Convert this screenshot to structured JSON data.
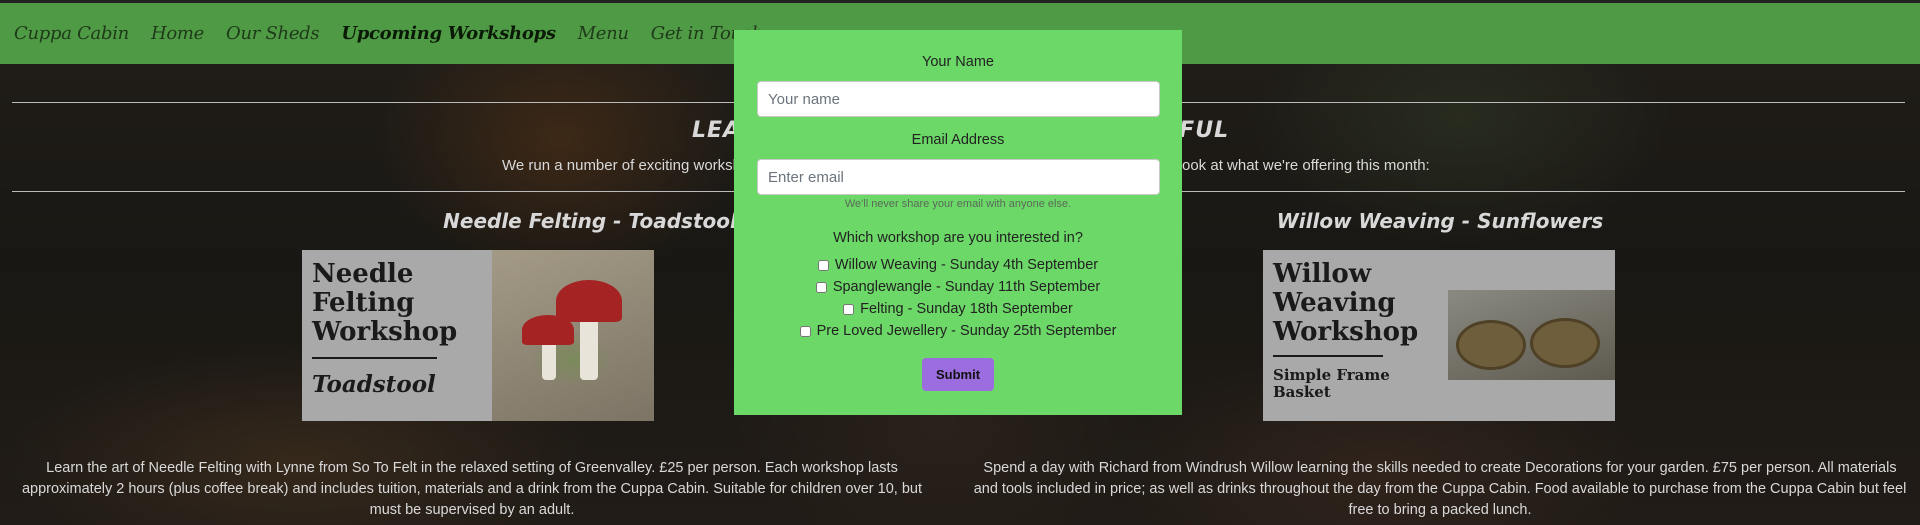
{
  "nav": {
    "brand": "Cuppa Cabin",
    "items": [
      "Home",
      "Our Sheds",
      "Upcoming Workshops",
      "Menu",
      "Get in Touch"
    ],
    "active": "Upcoming Workshops"
  },
  "intro": {
    "heading_left": "LEAI",
    "heading_right": "IFUL",
    "text_left": "We run a number of exciting worksho",
    "text_right": "ook at what we're offering this month:"
  },
  "workshops": [
    {
      "title": "Needle Felting - Toadstool",
      "image_lines": [
        "Needle",
        "Felting",
        "Workshop"
      ],
      "image_sub": "Toadstool",
      "description": "Learn the art of Needle Felting with Lynne from So To Felt in the relaxed setting of Greenvalley. £25 per person. Each workshop lasts approximately 2 hours (plus coffee break) and includes tuition, materials and a drink from the Cuppa Cabin. Suitable for children over 10, but must be supervised by an adult."
    },
    {
      "title": "Willow Weaving - Sunflowers",
      "image_lines": [
        "Willow",
        "Weaving",
        "Workshop"
      ],
      "image_sub": "Simple Frame Basket",
      "description": "Spend a day with Richard from Windrush Willow learning the skills needed to create Decorations for your garden. £75 per person. All materials and tools included in price; as well as drinks throughout the day from the Cuppa Cabin. Food available to purchase from the Cuppa Cabin but feel free to bring a packed lunch."
    }
  ],
  "modal": {
    "name_label": "Your Name",
    "name_placeholder": "Your name",
    "email_label": "Email Address",
    "email_placeholder": "Enter email",
    "email_help": "We'll never share your email with anyone else.",
    "workshop_question": "Which workshop are you interested in?",
    "options": [
      "Willow Weaving - Sunday 4th September",
      "Spanglewangle - Sunday 11th September",
      "Felting - Sunday 18th September",
      "Pre Loved Jewellery - Sunday 25th September"
    ],
    "submit_label": "Submit"
  },
  "colors": {
    "navbar": "#4f9a45",
    "modal_bg": "#6cd867",
    "submit_bg": "#9b6ddf"
  }
}
